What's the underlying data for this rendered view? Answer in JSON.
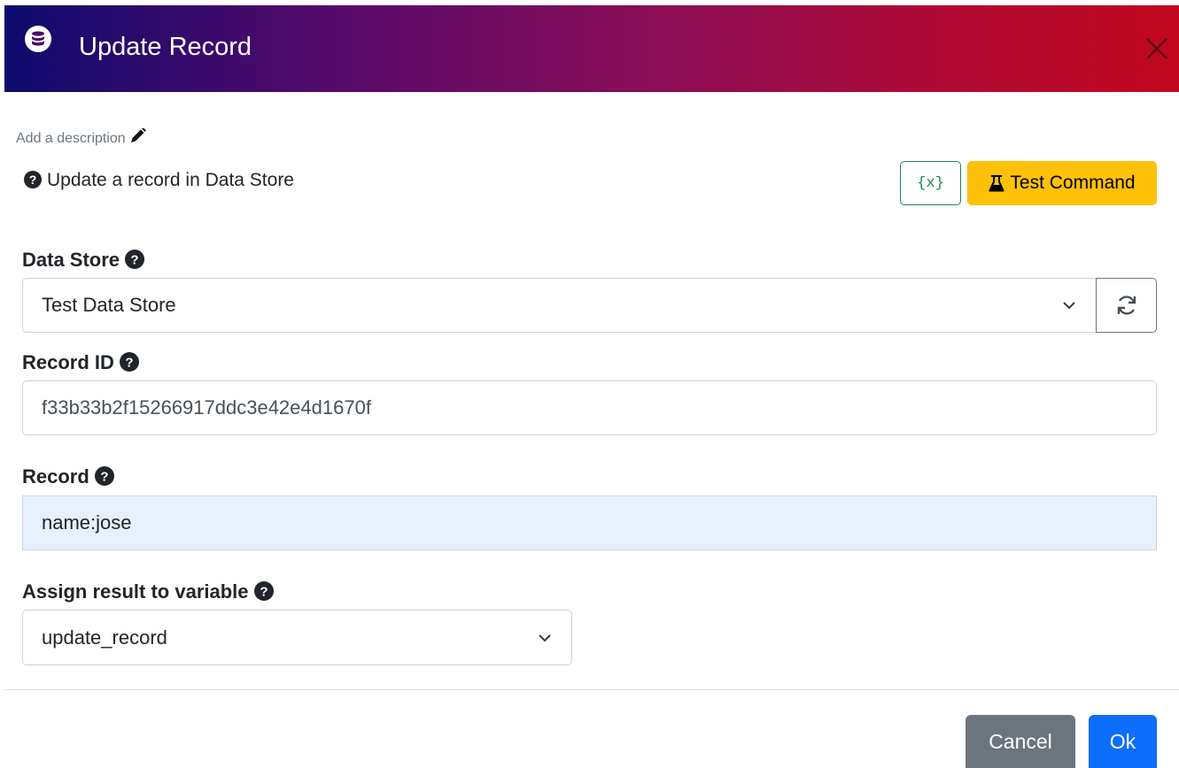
{
  "dialog": {
    "title": "Update Record",
    "header_gradient": [
      "#0e0a6e",
      "#c2081e"
    ],
    "header_icon": "database-icon",
    "close_icon": "close-icon"
  },
  "description": {
    "link_text": "Add a description",
    "icon": "pencil-icon",
    "help_text": "Update a record in Data Store",
    "help_icon": "question-circle-icon"
  },
  "toolbar": {
    "variables_label": "{x}",
    "test_label": "Test Command",
    "test_icon": "flask-icon",
    "test_color": "#ffc107",
    "variables_color": "#198754"
  },
  "fields": {
    "data_store": {
      "label": "Data Store",
      "value": "Test Data Store",
      "refresh_icon": "refresh-icon"
    },
    "record_id": {
      "label": "Record ID",
      "value": "f33b33b2f15266917ddc3e42e4d1670f"
    },
    "record": {
      "label": "Record",
      "value": "name:jose",
      "background": "#e8f0fe"
    },
    "assign": {
      "label": "Assign result to variable",
      "value": "update_record"
    }
  },
  "footer": {
    "cancel_label": "Cancel",
    "ok_label": "Ok",
    "cancel_color": "#6c757d",
    "ok_color": "#0d6efd"
  }
}
